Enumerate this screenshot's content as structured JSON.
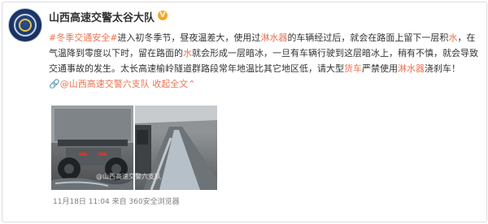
{
  "post": {
    "username": "山西高速交警太谷大队",
    "verified_badge": "V",
    "text": {
      "topic": "#冬季交通安全#",
      "seg1": "进入初冬季节，昼夜温差大，使用过",
      "kw_water_sprayer": "淋水器",
      "seg2": "的车辆经过后，就会在路面上留下一层积",
      "kw_water": "水",
      "seg3": "，在气温降到零度以下时，留在路面的",
      "kw_water2": "水",
      "seg4": "就会形成一层暗冰，一旦有车辆行驶到这层暗冰上，稍有不慎，就会导致交通事故的发生。太长高速榆岭隧道群路段常年地温比其它地区低，请大型",
      "kw_truck": "货车",
      "seg5": "严禁使用",
      "kw_water_sprayer2": "淋水器",
      "seg6": "浇刹车！",
      "mention_icon": "link-icon",
      "mention": "@山西高速交警六支队",
      "collapse": "收起全文",
      "collapse_icon": "chevron-up-icon"
    },
    "images": [
      {
        "name": "truck-rear-wet-road-photo"
      },
      {
        "name": "wet-highway-lane-photo"
      }
    ],
    "watermark": "@山西高速交警六支队",
    "footer": "11月18日 11:04 来自 360安全浏览器"
  }
}
